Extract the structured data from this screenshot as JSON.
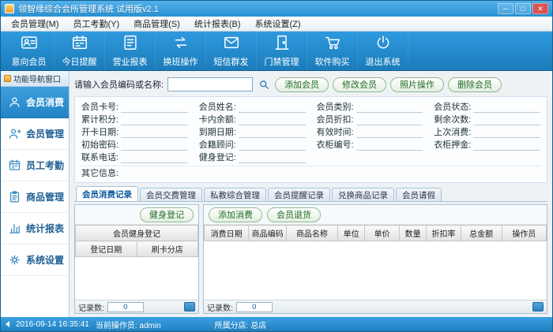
{
  "window": {
    "title": "领智缘综合会所管理系统 试用版v2.1",
    "controls": {
      "minimize": "─",
      "maximize": "□",
      "close": "✕"
    }
  },
  "menubar": {
    "items": [
      {
        "label": "会员管理(M)"
      },
      {
        "label": "员工考勤(Y)"
      },
      {
        "label": "商品管理(S)"
      },
      {
        "label": "统计报表(B)"
      },
      {
        "label": "系统设置(Z)"
      }
    ]
  },
  "toolbar": {
    "items": [
      {
        "label": "意向会员",
        "icon": "intent-member-icon"
      },
      {
        "label": "今日提醒",
        "icon": "today-reminder-icon"
      },
      {
        "label": "营业报表",
        "icon": "business-report-icon"
      },
      {
        "label": "换班操作",
        "icon": "shift-change-icon"
      },
      {
        "label": "短信群发",
        "icon": "sms-broadcast-icon"
      },
      {
        "label": "门禁管理",
        "icon": "access-control-icon"
      },
      {
        "label": "软件购买",
        "icon": "software-purchase-icon"
      },
      {
        "label": "退出系统",
        "icon": "exit-system-icon"
      }
    ]
  },
  "sidebar": {
    "header": "功能导航窗口",
    "items": [
      {
        "label": "会员消费",
        "icon": "member-consume-icon",
        "active": true
      },
      {
        "label": "会员管理",
        "icon": "member-manage-icon",
        "active": false
      },
      {
        "label": "员工考勤",
        "icon": "staff-attendance-icon",
        "active": false
      },
      {
        "label": "商品管理",
        "icon": "goods-manage-icon",
        "active": false
      },
      {
        "label": "统计报表",
        "icon": "stats-report-icon",
        "active": false
      },
      {
        "label": "系统设置",
        "icon": "system-settings-icon",
        "active": false
      }
    ]
  },
  "search": {
    "label": "请输入会员编码或名称:",
    "value": "",
    "buttons": [
      {
        "label": "添加会员"
      },
      {
        "label": "修改会员"
      },
      {
        "label": "照片操作"
      },
      {
        "label": "删除会员"
      }
    ]
  },
  "member_info": {
    "fields": [
      {
        "label": "会员卡号:",
        "value": ""
      },
      {
        "label": "会员姓名:",
        "value": ""
      },
      {
        "label": "会员类别:",
        "value": ""
      },
      {
        "label": "会员状态:",
        "value": ""
      },
      {
        "label": "累计积分:",
        "value": ""
      },
      {
        "label": "卡内余额:",
        "value": ""
      },
      {
        "label": "会员折扣:",
        "value": ""
      },
      {
        "label": "剩余次数:",
        "value": ""
      },
      {
        "label": "开卡日期:",
        "value": ""
      },
      {
        "label": "到期日期:",
        "value": ""
      },
      {
        "label": "有效时间:",
        "value": ""
      },
      {
        "label": "上次消费:",
        "value": ""
      },
      {
        "label": "初始密码:",
        "value": ""
      },
      {
        "label": "会籍顾问:",
        "value": ""
      },
      {
        "label": "衣柜编号:",
        "value": ""
      },
      {
        "label": "衣柜押金:",
        "value": ""
      },
      {
        "label": "联系电话:",
        "value": ""
      },
      {
        "label": "健身登记:",
        "value": ""
      }
    ],
    "other_label": "其它信息:",
    "other_value": ""
  },
  "tabs": [
    {
      "label": "会员消费记录",
      "active": true
    },
    {
      "label": "会员交费管理",
      "active": false
    },
    {
      "label": "私教综合管理",
      "active": false
    },
    {
      "label": "会员提醒记录",
      "active": false
    },
    {
      "label": "兑换商品记录",
      "active": false
    },
    {
      "label": "会员请假",
      "active": false
    }
  ],
  "checkin_panel": {
    "button": "健身登记",
    "table_title": "会员健身登记",
    "columns": [
      "登记日期",
      "刷卡分店"
    ],
    "rows": [],
    "record_count_label": "记录数:",
    "record_count": "0"
  },
  "consume_panel": {
    "buttons": [
      {
        "label": "添加消费"
      },
      {
        "label": "会员退货"
      }
    ],
    "columns": [
      "消费日期",
      "商品编码",
      "商品名称",
      "单位",
      "单价",
      "数量",
      "折扣率",
      "总金额",
      "操作员"
    ],
    "rows": [],
    "record_count_label": "记录数:",
    "record_count": "0"
  },
  "statusbar": {
    "datetime": "2016-09-14 16:35:41",
    "operator_label": "当前操作员:",
    "operator": "admin",
    "branch_label": "所属分店:",
    "branch": "总店"
  }
}
